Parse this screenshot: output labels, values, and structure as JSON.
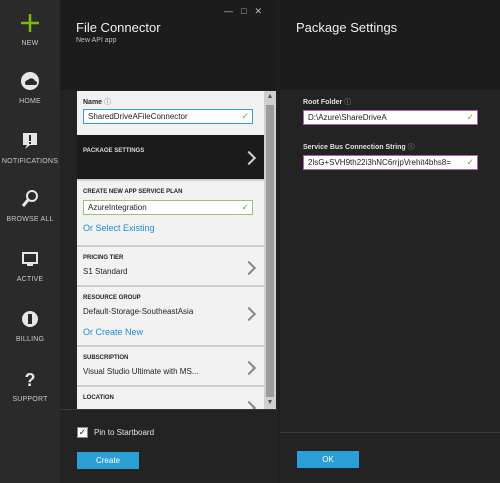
{
  "nav": {
    "items": [
      {
        "key": "new",
        "label": "NEW",
        "icon": "plus-icon"
      },
      {
        "key": "home",
        "label": "HOME",
        "icon": "cloud-icon"
      },
      {
        "key": "notifications",
        "label": "NOTIFICATIONS",
        "icon": "notification-icon"
      },
      {
        "key": "browse",
        "label": "BROWSE ALL",
        "icon": "browse-icon"
      },
      {
        "key": "active",
        "label": "ACTIVE",
        "icon": "active-icon"
      },
      {
        "key": "billing",
        "label": "BILLING",
        "icon": "billing-icon"
      },
      {
        "key": "support",
        "label": "SUPPORT",
        "icon": "help-icon"
      }
    ],
    "accent": "#7fba00"
  },
  "connector": {
    "title": "File Connector",
    "subtitle": "New API app",
    "name_label": "Name",
    "name_value": "SharedDriveAFileConnector",
    "package_settings_label": "PACKAGE SETTINGS",
    "plan_label": "CREATE NEW APP SERVICE PLAN",
    "plan_value": "AzureIntegration",
    "plan_link": "Or Select Existing",
    "tier_label": "PRICING TIER",
    "tier_value": "S1 Standard",
    "rg_label": "RESOURCE GROUP",
    "rg_value": "Default-Storage-SoutheastAsia",
    "rg_link": "Or Create New",
    "subscription_label": "SUBSCRIPTION",
    "subscription_value": "Visual Studio Ultimate with MS...",
    "location_label": "LOCATION",
    "pin_label": "Pin to Startboard",
    "pin_checked": true,
    "create_label": "Create"
  },
  "package": {
    "title": "Package Settings",
    "root_label": "Root Folder",
    "root_value": "D:\\Azure\\ShareDriveA",
    "sb_label": "Service Bus Connection String",
    "sb_value": "2lsG+SVH9th22i3hNC6rrjpVrehit4bhs8=",
    "ok_label": "OK"
  },
  "colors": {
    "button": "#2a9fd6",
    "valid": "#6aa83a",
    "focus_border": "#b45db6"
  }
}
